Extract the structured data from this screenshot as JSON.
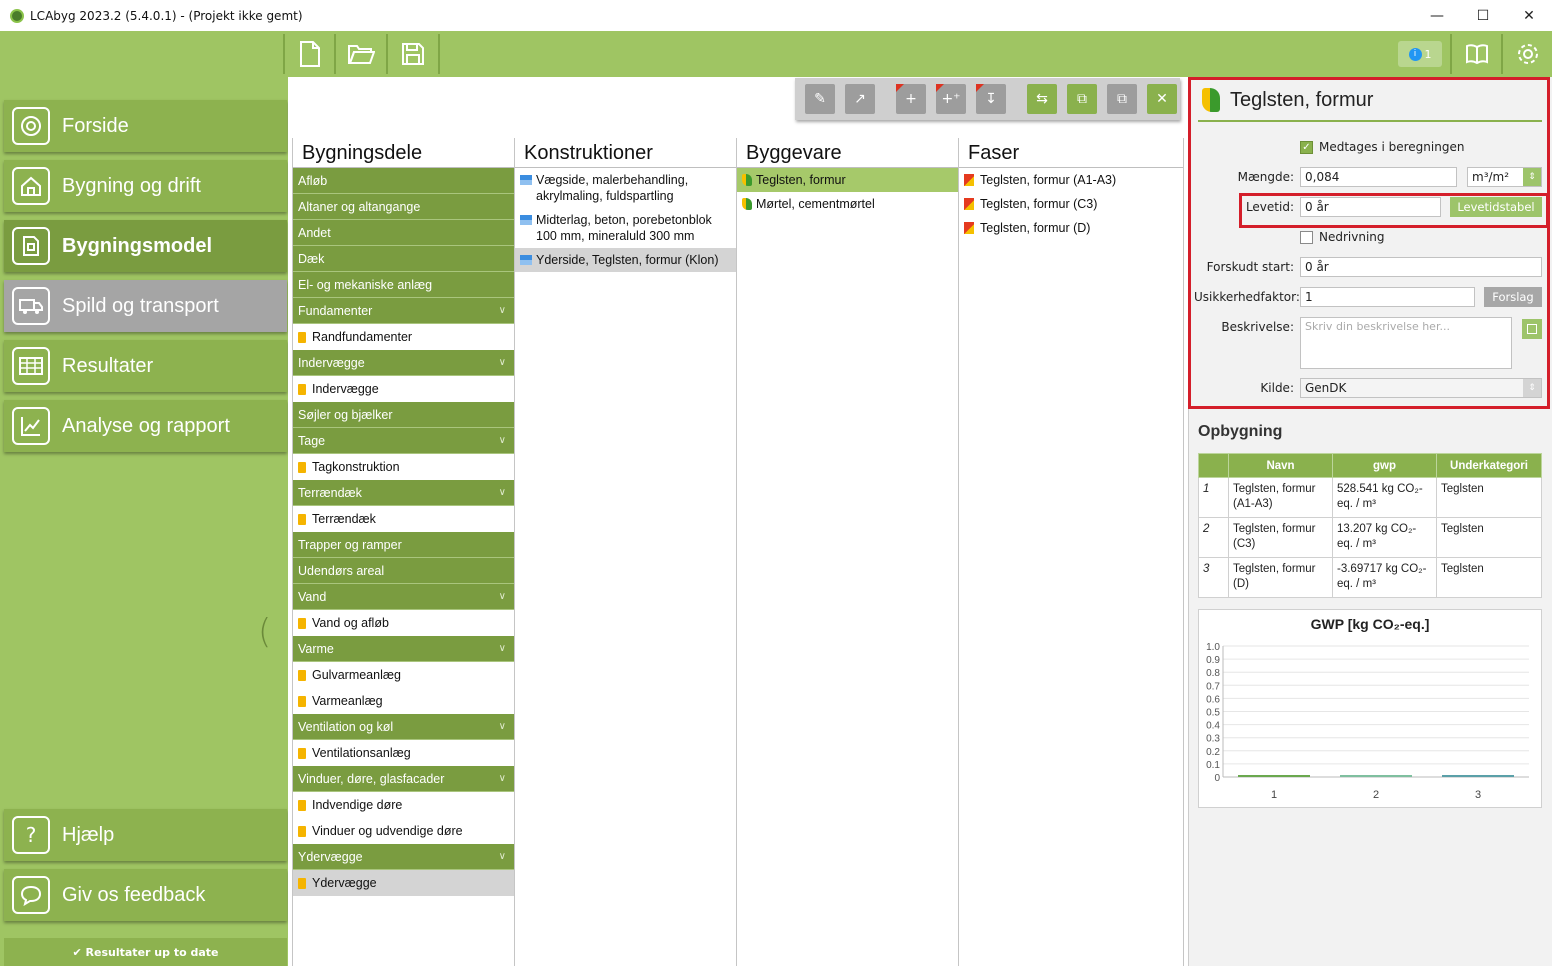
{
  "window": {
    "title": "LCAbyg 2023.2 (5.4.0.1) - (Projekt ikke gemt)",
    "minimize": "—",
    "maximize": "☐",
    "close": "✕"
  },
  "topbar": {
    "notification_count": "1"
  },
  "nav": {
    "items": [
      {
        "label": "Forside",
        "icon": "home-circle-icon"
      },
      {
        "label": "Bygning og drift",
        "icon": "house-icon"
      },
      {
        "label": "Bygningsmodel",
        "icon": "model-document-icon"
      },
      {
        "label": "Spild og transport",
        "icon": "truck-icon"
      },
      {
        "label": "Resultater",
        "icon": "table-icon"
      },
      {
        "label": "Analyse og rapport",
        "icon": "chart-icon"
      }
    ],
    "help": "Hjælp",
    "feedback": "Giv os feedback",
    "status": "✔ Resultater up to date"
  },
  "columns": {
    "bygningsdele": {
      "header": "Bygningsdele",
      "items": [
        {
          "label": "Afløb",
          "type": "cat",
          "chevron": false
        },
        {
          "label": "Altaner og altangange",
          "type": "cat",
          "chevron": false
        },
        {
          "label": "Andet",
          "type": "cat",
          "chevron": false
        },
        {
          "label": "Dæk",
          "type": "cat",
          "chevron": false
        },
        {
          "label": "El- og mekaniske anlæg",
          "type": "cat",
          "chevron": false
        },
        {
          "label": "Fundamenter",
          "type": "cat",
          "chevron": true
        },
        {
          "label": "Randfundamenter",
          "type": "sub",
          "selected": false
        },
        {
          "label": "Indervægge",
          "type": "cat",
          "chevron": true
        },
        {
          "label": "Indervægge",
          "type": "sub",
          "selected": false
        },
        {
          "label": "Søjler og bjælker",
          "type": "cat",
          "chevron": false
        },
        {
          "label": "Tage",
          "type": "cat",
          "chevron": true
        },
        {
          "label": "Tagkonstruktion",
          "type": "sub",
          "selected": false
        },
        {
          "label": "Terrændæk",
          "type": "cat",
          "chevron": true
        },
        {
          "label": "Terrændæk",
          "type": "sub",
          "selected": false
        },
        {
          "label": "Trapper og ramper",
          "type": "cat",
          "chevron": false
        },
        {
          "label": "Udendørs areal",
          "type": "cat",
          "chevron": false
        },
        {
          "label": "Vand",
          "type": "cat",
          "chevron": true
        },
        {
          "label": "Vand og afløb",
          "type": "sub",
          "selected": false
        },
        {
          "label": "Varme",
          "type": "cat",
          "chevron": true
        },
        {
          "label": "Gulvarmeanlæg",
          "type": "sub",
          "selected": false
        },
        {
          "label": "Varmeanlæg",
          "type": "sub",
          "selected": false
        },
        {
          "label": "Ventilation og køl",
          "type": "cat",
          "chevron": true
        },
        {
          "label": "Ventilationsanlæg",
          "type": "sub",
          "selected": false
        },
        {
          "label": "Vinduer, døre, glasfacader",
          "type": "cat",
          "chevron": true
        },
        {
          "label": "Indvendige døre",
          "type": "sub",
          "selected": false
        },
        {
          "label": "Vinduer og udvendige døre",
          "type": "sub",
          "selected": false
        },
        {
          "label": "Ydervægge",
          "type": "cat",
          "chevron": true
        },
        {
          "label": "Ydervægge",
          "type": "sub",
          "selected": true
        }
      ]
    },
    "konstruktioner": {
      "header": "Konstruktioner",
      "items": [
        {
          "label": "Vægside, malerbehandling, akrylmaling, fuldspartling",
          "selected": false
        },
        {
          "label": "Midterlag, beton, porebetonblok 100 mm, mineraluld 300 mm",
          "selected": false
        },
        {
          "label": "Yderside, Teglsten, formur (Klon)",
          "selected": true
        }
      ]
    },
    "byggevare": {
      "header": "Byggevare",
      "items": [
        {
          "label": "Teglsten, formur",
          "selected": true
        },
        {
          "label": "Mørtel, cementmørtel",
          "selected": false
        }
      ]
    },
    "faser": {
      "header": "Faser",
      "items": [
        {
          "label": "Teglsten, formur (A1-A3)"
        },
        {
          "label": "Teglsten, formur (C3)"
        },
        {
          "label": "Teglsten, formur (D)"
        }
      ]
    }
  },
  "details": {
    "title": "Teglsten, formur",
    "include_label": "Medtages i beregningen",
    "include_checked": true,
    "amount_label": "Mængde:",
    "amount_value": "0,084",
    "amount_unit": "m³/m²",
    "lifetime_label": "Levetid:",
    "lifetime_value": "0 år",
    "lifetime_table_button": "Levetidstabel",
    "demolition_label": "Nedrivning",
    "demolition_checked": false,
    "delayed_start_label": "Forskudt start:",
    "delayed_start_value": "0 år",
    "uncertainty_label": "Usikkerhedfaktor:",
    "uncertainty_value": "1",
    "suggestion_button": "Forslag",
    "description_label": "Beskrivelse:",
    "description_placeholder": "Skriv din beskrivelse her...",
    "source_label": "Kilde:",
    "source_value": "GenDK"
  },
  "opbygning": {
    "title": "Opbygning",
    "columns": [
      "Navn",
      "gwp",
      "Underkategori"
    ],
    "rows": [
      {
        "idx": "1",
        "navn": "Teglsten, formur (A1-A3)",
        "gwp": "528.541 kg CO₂-eq. / m³",
        "underkategori": "Teglsten"
      },
      {
        "idx": "2",
        "navn": "Teglsten, formur (C3)",
        "gwp": "13.207 kg CO₂-eq. / m³",
        "underkategori": "Teglsten"
      },
      {
        "idx": "3",
        "navn": "Teglsten, formur (D)",
        "gwp": "-3.69717 kg CO₂-eq. / m³",
        "underkategori": "Teglsten"
      }
    ]
  },
  "chart_data": {
    "type": "bar",
    "title": "GWP [kg CO₂-eq.]",
    "categories": [
      "1",
      "2",
      "3"
    ],
    "values": [
      0,
      0,
      0
    ],
    "ylim": [
      0,
      1.0
    ],
    "yticks": [
      "1.0",
      "0.9",
      "0.8",
      "0.7",
      "0.6",
      "0.5",
      "0.4",
      "0.3",
      "0.2",
      "0.1",
      "0"
    ],
    "grid": true,
    "colors": [
      "#6aa84f",
      "#7fbf9f",
      "#5aa0a8"
    ]
  },
  "colors": {
    "accent_green": "#9fc563",
    "dark_green": "#7a9c40",
    "highlight_red": "#d41e2a"
  }
}
